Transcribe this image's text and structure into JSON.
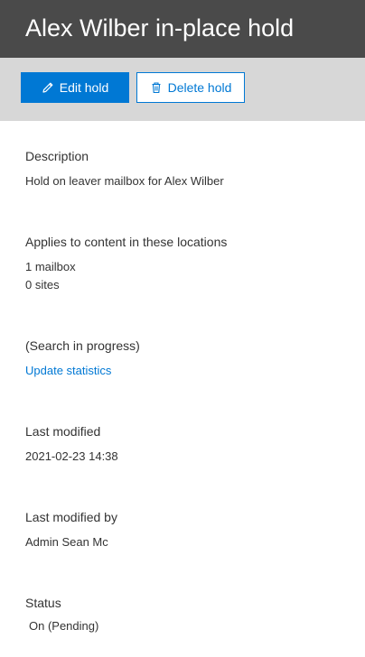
{
  "panel": {
    "title": "Alex Wilber in-place hold"
  },
  "toolbar": {
    "edit_label": "Edit hold",
    "edit_icon": "pencil-icon",
    "delete_label": "Delete hold",
    "delete_icon": "trash-icon"
  },
  "details": {
    "description": {
      "label": "Description",
      "value": "Hold on leaver mailbox for Alex Wilber"
    },
    "locations": {
      "label": "Applies to content in these locations",
      "mailboxes": "1 mailbox",
      "sites": "0 sites"
    },
    "search": {
      "label": "(Search in progress)",
      "link": "Update statistics"
    },
    "last_modified": {
      "label": "Last modified",
      "value": "2021-02-23 14:38"
    },
    "last_modified_by": {
      "label": "Last modified by",
      "value": "Admin Sean Mc"
    },
    "status": {
      "label": "Status",
      "value": "On (Pending)"
    }
  },
  "colors": {
    "header_bg": "#4a4a4a",
    "toolbar_bg": "#d7d7d7",
    "accent": "#0078d4"
  }
}
